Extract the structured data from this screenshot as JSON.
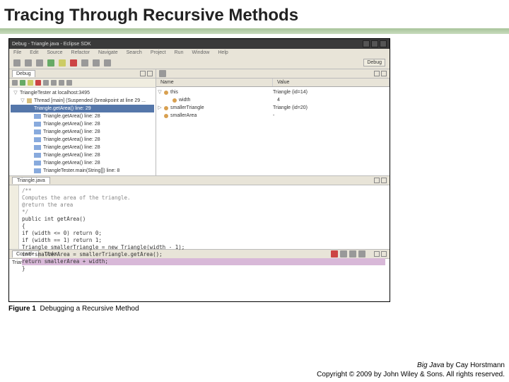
{
  "slide": {
    "title": "Tracing Through Recursive Methods"
  },
  "ide": {
    "window_title": "Debug - Triangle.java - Eclipse SDK",
    "menu": [
      "File",
      "Edit",
      "Source",
      "Refactor",
      "Navigate",
      "Search",
      "Project",
      "Run",
      "Window",
      "Help"
    ],
    "perspective": "Debug",
    "debug_tab": "Debug",
    "debug_tree": [
      {
        "indent": 0,
        "tw": "▽",
        "label": "TriangleTester at localhost:3495"
      },
      {
        "indent": 1,
        "tw": "▽",
        "label": "Thread [main] (Suspended (breakpoint at line 29 ..."
      },
      {
        "indent": 2,
        "tw": "",
        "label": "Triangle.getArea() line: 29",
        "sel": true
      },
      {
        "indent": 2,
        "tw": "",
        "label": "Triangle.getArea() line: 28",
        "bar": true
      },
      {
        "indent": 2,
        "tw": "",
        "label": "Triangle.getArea() line: 28",
        "bar": true
      },
      {
        "indent": 2,
        "tw": "",
        "label": "Triangle.getArea() line: 28",
        "bar": true
      },
      {
        "indent": 2,
        "tw": "",
        "label": "Triangle.getArea() line: 28",
        "bar": true
      },
      {
        "indent": 2,
        "tw": "",
        "label": "Triangle.getArea() line: 28",
        "bar": true
      },
      {
        "indent": 2,
        "tw": "",
        "label": "Triangle.getArea() line: 28",
        "bar": true
      },
      {
        "indent": 2,
        "tw": "",
        "label": "Triangle.getArea() line: 28",
        "bar": true
      },
      {
        "indent": 2,
        "tw": "",
        "label": "TriangleTester.main(String[]) line: 8",
        "bar": true
      }
    ],
    "vars": {
      "col_name": "Name",
      "col_value": "Value",
      "rows": [
        {
          "indent": 0,
          "tw": "▽",
          "name": "this",
          "value": "Triangle (id=14)"
        },
        {
          "indent": 1,
          "tw": "",
          "name": "width",
          "value": "4"
        },
        {
          "indent": 0,
          "tw": "▷",
          "name": "smallerTriangle",
          "value": "Triangle (id=20)"
        },
        {
          "indent": 0,
          "tw": "",
          "name": "smallerArea",
          "value": "-"
        }
      ]
    },
    "editor": {
      "tab": "Triangle.java",
      "lines": [
        {
          "t": "/**",
          "cls": "c"
        },
        {
          "t": "   Computes the area of the triangle.",
          "cls": "c"
        },
        {
          "t": "   @return the area",
          "cls": "c"
        },
        {
          "t": "*/",
          "cls": "c"
        },
        {
          "t": "public int getArea()"
        },
        {
          "t": "{"
        },
        {
          "t": "   if (width <= 0) return 0;"
        },
        {
          "t": "   if (width == 1) return 1;"
        },
        {
          "t": "   Triangle smallerTriangle = new Triangle(width - 1);"
        },
        {
          "t": "   int smallerArea = smallerTriangle.getArea();"
        },
        {
          "t": "   return smallerArea + width;",
          "cls": "hl"
        },
        {
          "t": "}"
        }
      ]
    },
    "console": {
      "tab1": "Console",
      "tab2": "Tasks",
      "line": "TriangleTester [Java Application] /home/cay/jdk1.6.0_14/bin/java (Sep 1, 2009 4:52:44 PM)"
    }
  },
  "figure": {
    "num": "Figure 1",
    "caption": "Debugging a Recursive Method"
  },
  "footer": {
    "book": "Big Java",
    "author": " by Cay Horstmann",
    "copyright": "Copyright © 2009 by John Wiley & Sons. All rights reserved."
  }
}
